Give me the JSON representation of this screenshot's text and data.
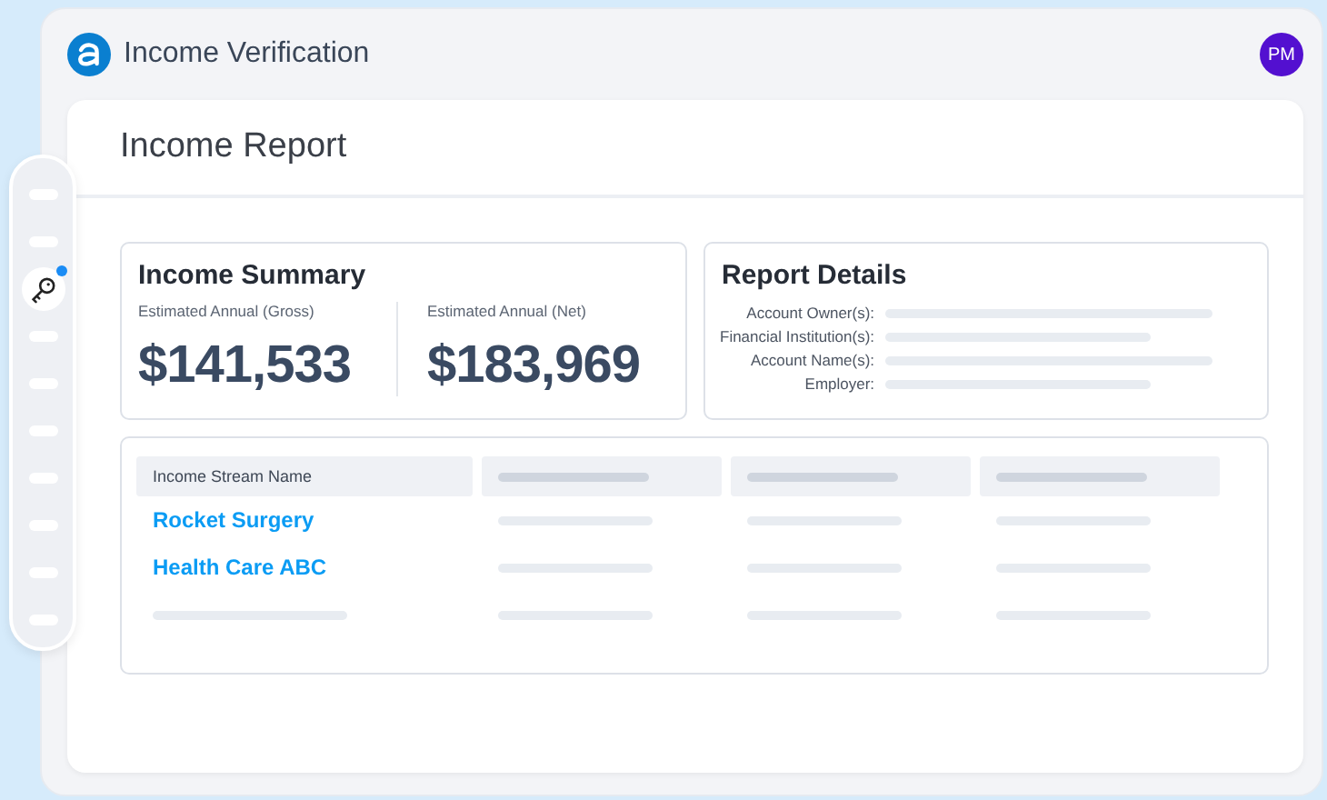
{
  "app": {
    "title": "Income Verification",
    "avatar": "PM"
  },
  "sidebar": {
    "items": [
      {
        "kind": "placeholder",
        "selected": false
      },
      {
        "kind": "placeholder",
        "selected": false
      },
      {
        "kind": "key",
        "selected": true
      },
      {
        "kind": "placeholder",
        "selected": false
      },
      {
        "kind": "placeholder",
        "selected": false
      },
      {
        "kind": "placeholder",
        "selected": false
      },
      {
        "kind": "placeholder",
        "selected": false
      },
      {
        "kind": "placeholder",
        "selected": false
      },
      {
        "kind": "placeholder",
        "selected": false
      },
      {
        "kind": "placeholder",
        "selected": false
      }
    ]
  },
  "page": {
    "title": "Income Report"
  },
  "income_summary": {
    "title": "Income Summary",
    "figures": [
      {
        "label": "Estimated Annual (Gross)",
        "value": "$141,533"
      },
      {
        "label": "Estimated Annual (Net)",
        "value": "$183,969"
      }
    ]
  },
  "report_details": {
    "title": "Report Details",
    "fields": [
      {
        "label": "Account Owner(s):"
      },
      {
        "label": "Financial Institution(s):"
      },
      {
        "label": "Account Name(s):"
      },
      {
        "label": "Employer:"
      }
    ]
  },
  "table": {
    "columns": [
      {
        "kind": "text",
        "label": "Income Stream Name"
      },
      {
        "kind": "placeholder"
      },
      {
        "kind": "placeholder"
      },
      {
        "kind": "placeholder"
      }
    ],
    "rows": [
      {
        "kind": "link",
        "name": "Rocket Surgery"
      },
      {
        "kind": "link",
        "name": "Health Care ABC"
      },
      {
        "kind": "placeholder"
      }
    ]
  }
}
